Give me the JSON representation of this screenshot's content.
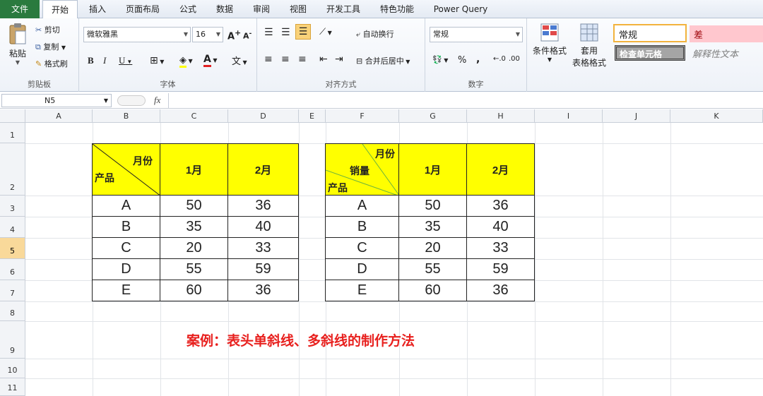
{
  "tabs": [
    "文件",
    "开始",
    "插入",
    "页面布局",
    "公式",
    "数据",
    "审阅",
    "视图",
    "开发工具",
    "特色功能",
    "Power Query"
  ],
  "clipboard": {
    "paste": "粘贴",
    "cut": "剪切",
    "copy": "复制",
    "format_painter": "格式刷",
    "label": "剪贴板"
  },
  "font": {
    "name": "微软雅黑",
    "size": "16",
    "label": "字体",
    "bold": "B",
    "italic": "I",
    "underline": "U"
  },
  "alignment": {
    "wrap": "自动换行",
    "merge": "合并后居中",
    "label": "对齐方式"
  },
  "number": {
    "format": "常规",
    "label": "数字",
    "percent": "%",
    "comma": ","
  },
  "styles": {
    "conditional": "条件格式",
    "table_line1": "套用",
    "table_line2": "表格格式",
    "normal": "常规",
    "bad": "差",
    "check": "检查单元格",
    "explanatory": "解释性文本"
  },
  "formula_bar": {
    "name_box": "N5",
    "fx": "fx",
    "value": ""
  },
  "columns": [
    "A",
    "B",
    "C",
    "D",
    "E",
    "F",
    "G",
    "H",
    "I",
    "J",
    "K"
  ],
  "rows": [
    "1",
    "2",
    "3",
    "4",
    "5",
    "6",
    "7",
    "8",
    "9",
    "10",
    "11"
  ],
  "selected_row": "5",
  "table1": {
    "header_top": "月份",
    "header_bottom": "产品",
    "months": [
      "1月",
      "2月"
    ],
    "data": [
      [
        "A",
        "50",
        "36"
      ],
      [
        "B",
        "35",
        "40"
      ],
      [
        "C",
        "20",
        "33"
      ],
      [
        "D",
        "55",
        "59"
      ],
      [
        "E",
        "60",
        "36"
      ]
    ]
  },
  "table2": {
    "header_top": "月份",
    "header_mid": "销量",
    "header_bottom": "产品",
    "months": [
      "1月",
      "2月"
    ],
    "data": [
      [
        "A",
        "50",
        "36"
      ],
      [
        "B",
        "35",
        "40"
      ],
      [
        "C",
        "20",
        "33"
      ],
      [
        "D",
        "55",
        "59"
      ],
      [
        "E",
        "60",
        "36"
      ]
    ]
  },
  "caption": "案例：表头单斜线、多斜线的制作方法",
  "colors": {
    "header_fill": "#ffff00",
    "caption": "#e8201e",
    "file_tab": "#2a7a3e",
    "selected_row": "#f9d99a"
  }
}
